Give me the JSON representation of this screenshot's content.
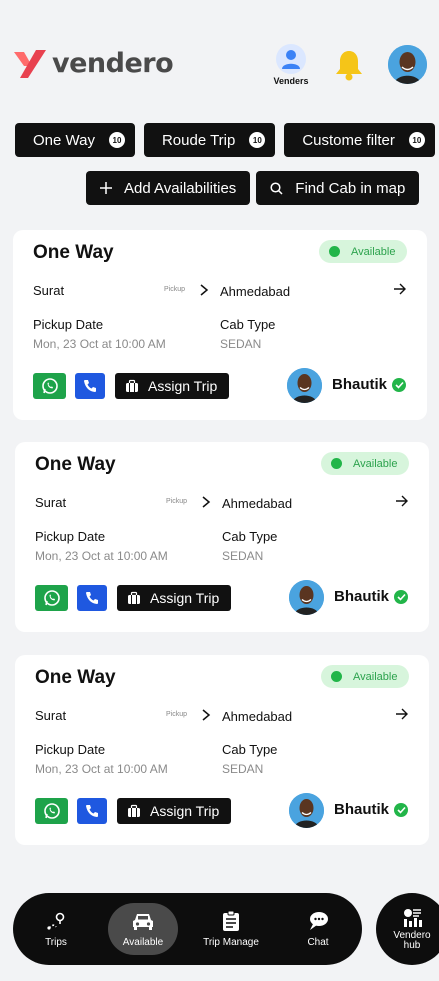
{
  "header": {
    "brand": "vendero",
    "venders_label": "Venders"
  },
  "filters": [
    {
      "label": "One Way",
      "count": "10"
    },
    {
      "label": "Roude Trip",
      "count": "10"
    },
    {
      "label": "Custome filter",
      "count": "10"
    }
  ],
  "actions": {
    "add_label": "Add Availabilities",
    "find_label": "Find Cab in map"
  },
  "cards": [
    {
      "title": "One Way",
      "status": "Available",
      "from": "Surat",
      "pickup_tag": "Pickup",
      "to": "Ahmedabad",
      "pickup_date_label": "Pickup Date",
      "pickup_date": "Mon, 23 Oct at 10:00 AM",
      "cab_type_label": "Cab Type",
      "cab_type": "SEDAN",
      "assign_label": "Assign Trip",
      "driver": "Bhautik"
    },
    {
      "title": "One Way",
      "status": "Available",
      "from": "Surat",
      "pickup_tag": "Pickup",
      "to": "Ahmedabad",
      "pickup_date_label": "Pickup Date",
      "pickup_date": "Mon, 23 Oct at 10:00 AM",
      "cab_type_label": "Cab Type",
      "cab_type": "SEDAN",
      "assign_label": "Assign Trip",
      "driver": "Bhautik"
    },
    {
      "title": "One Way",
      "status": "Available",
      "from": "Surat",
      "pickup_tag": "Pickup",
      "to": "Ahmedabad",
      "pickup_date_label": "Pickup Date",
      "pickup_date": "Mon, 23 Oct at 10:00 AM",
      "cab_type_label": "Cab Type",
      "cab_type": "SEDAN",
      "assign_label": "Assign Trip",
      "driver": "Bhautik"
    }
  ],
  "nav": {
    "items": [
      {
        "label": "Trips",
        "icon": "trips-icon"
      },
      {
        "label": "Available",
        "icon": "car-icon",
        "active": true
      },
      {
        "label": "Trip Manage",
        "icon": "clipboard-icon"
      },
      {
        "label": "Chat",
        "icon": "chat-icon"
      }
    ],
    "hub_line1": "Vendero",
    "hub_line2": "hub"
  },
  "colors": {
    "accent": "#111111",
    "available_bg": "#d7f5dc",
    "available_text": "#2ca24d",
    "whatsapp": "#1ea34a",
    "phone": "#1f58e0",
    "brand_red": "#e8414f"
  }
}
